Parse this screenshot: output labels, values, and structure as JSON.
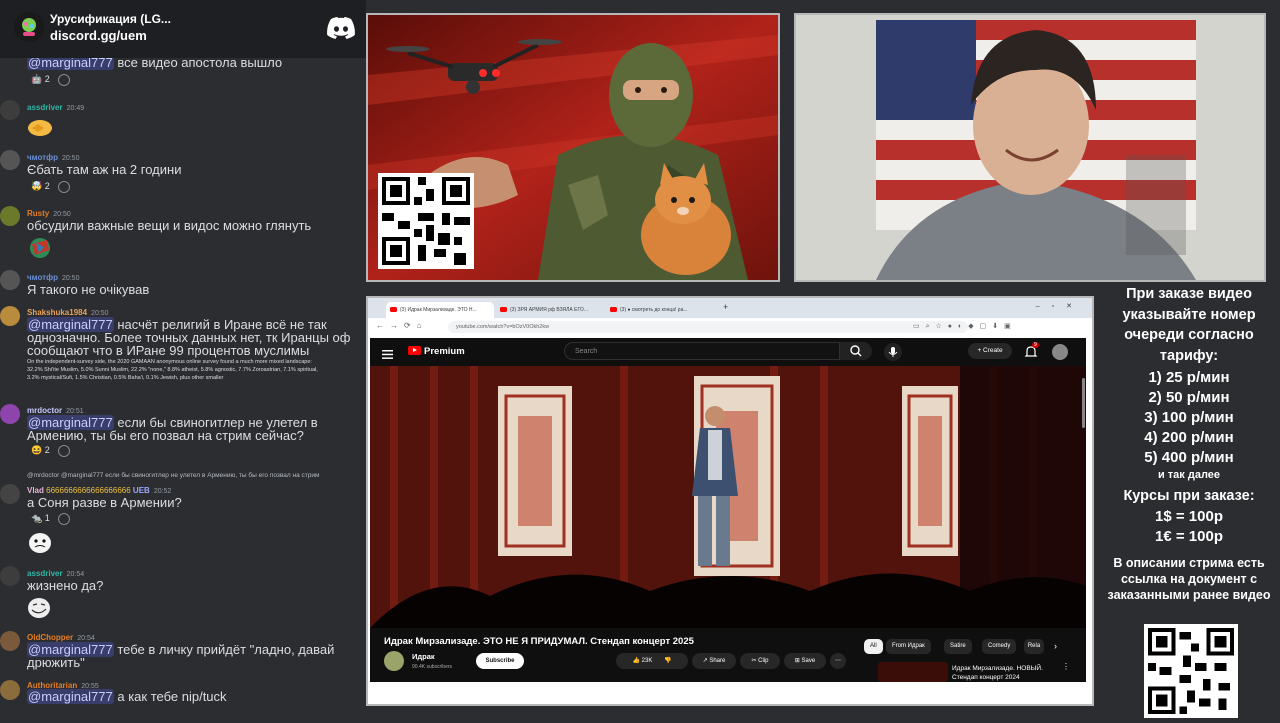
{
  "server": {
    "name": "Урусификация (LG...",
    "invite": "discord.gg/uem"
  },
  "messages": [
    {
      "user": "",
      "time": "",
      "text_mention": "@marginal777",
      "text": " все видео апостола вышло",
      "reaction_count": "2"
    },
    {
      "user": "assdriver",
      "time": "20:49",
      "reaction_emoji": "handshake"
    },
    {
      "user": "чмотфр",
      "time": "20:50",
      "text": "Єбать там аж на 2 години",
      "reaction_count": "2"
    },
    {
      "user": "Rusty",
      "time": "20:50",
      "text": "обсудили важные вещи и видос можно глянуть",
      "reaction_emoji": "globe"
    },
    {
      "user": "чмотфр",
      "time": "20:50",
      "text": "Я такого не очікував"
    },
    {
      "user": "Shakshuka1984",
      "time": "20:50",
      "text_mention": "@marginal777",
      "text": " насчёт религий в Иране всё не так однозначно. Более точных данных нет, тк Иранцы оф сообщают что в ИРане 99 процентов муслимы",
      "embed": "On the independent-survey side, the 2020 GAMAAN anonymous online survey found a much more mixed landscape: 32.2% Shi'ite Muslim, 5.0% Sunni Muslim, 22.2% \"none,\" 8.8% atheist, 5.8% agnostic, 7.7% Zoroastrian, 7.1% spiritual, 3.2% mystical/Sufi, 1.5% Christian, 0.5% Baha'i, 0.1% Jewish, plus other smaller"
    },
    {
      "user": "mrdoctor",
      "time": "20:51",
      "text_mention": "@marginal777",
      "text": " если бы свиногитлер не улетел в Армению, ты бы его позвал на стрим сейчас?",
      "reaction_count": "2"
    },
    {
      "user": "Vlad",
      "time": "20:52",
      "reply": "@mrdoctor @marginal777 если бы свиногитлер не улетел в Армению, ты бы его позвал на стрим",
      "name_suffix": "6666666666666666666",
      "tag": "UEB",
      "text": "а Соня разве в Армении?",
      "reaction_count": "1"
    },
    {
      "user": "assdriver",
      "time": "20:54",
      "text": "жизнено да?"
    },
    {
      "user": "OldChopper",
      "time": "20:54",
      "text_mention": "@marginal777",
      "text": " тебе в личку прийдёт \"ладно, давай дрюжить\""
    },
    {
      "user": "Authoritarian",
      "time": "20:55",
      "text_mention": "@marginal777",
      "text": " а как тебе nip/tuck"
    }
  ],
  "browser": {
    "tabs": [
      "(3) Идрак Мирзализаде. ЭТО Н...",
      "(3) ЗРЯ АРМИЯ рф ВЗЯЛА ЕГО...",
      "(3) ● смотреть до конца! ра..."
    ],
    "url": "youtube.com/watch?v=bOzV0Okh2kw"
  },
  "youtube": {
    "logo": "Premium",
    "search_placeholder": "Search",
    "create": "Create",
    "notif_count": "9",
    "title": "Идрак Мирзализаде. ЭТО НЕ Я ПРИДУМАЛ. Стендап концерт 2025",
    "channel": "Идрак",
    "subscribers": "90.4K subscribers",
    "subscribe": "Subscribe",
    "likes": "23K",
    "share": "Share",
    "clip": "Clip",
    "save": "Save",
    "chips": [
      "All",
      "From Идрак",
      "Satire",
      "Comedy",
      "Rela"
    ],
    "reco_title": "Идрак Мирзализаде. НОВЫЙ. Стендап концерт 2024"
  },
  "info": {
    "header": "При заказе видео указывайте номер очереди согласно тарифу:",
    "tariffs": [
      "1) 25 р/мин",
      "2) 50 р/мин",
      "3) 100 р/мин",
      "4) 200 р/мин",
      "5) 400 р/мин"
    ],
    "etc": "и так далее",
    "rates_title": "Курсы при заказе:",
    "rates": [
      "1$ = 100р",
      "1€ = 100р"
    ],
    "note": "В описании стрима есть ссылка на документ с заказанными ранее видео"
  },
  "colors": {
    "discord_bg": "#2b2d31",
    "mention": "#c9cdfb",
    "youtube_red": "#ff0000"
  }
}
